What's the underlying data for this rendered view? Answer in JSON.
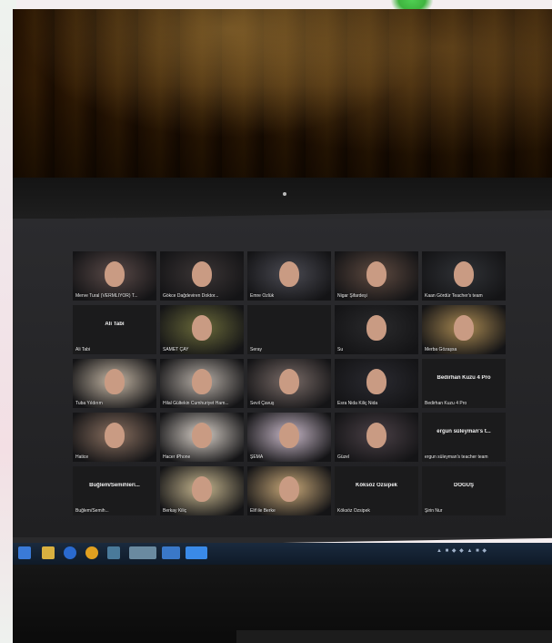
{
  "scene": "photo of a laptop screen showing a video conference gallery view",
  "participants": [
    {
      "name": "Merve Tural (VERMLİYOR) T...",
      "kind": "video"
    },
    {
      "name": "Gökce Dağdeviren Doktor...",
      "kind": "video"
    },
    {
      "name": "Emre Özlük",
      "kind": "video"
    },
    {
      "name": "Nigar Şifardeşi",
      "kind": "video"
    },
    {
      "name": "Kaan Gördür Teacher's team",
      "kind": "video"
    },
    {
      "name": "Ali Tabi",
      "kind": "name",
      "label": "Ali Tabi"
    },
    {
      "name": "SAMET ÇAY",
      "kind": "video"
    },
    {
      "name": "Seray",
      "kind": "blank"
    },
    {
      "name": "Su",
      "kind": "video"
    },
    {
      "name": "Merba Gözaşsa",
      "kind": "video"
    },
    {
      "name": "Tuba Yıldırım",
      "kind": "video"
    },
    {
      "name": "Hilal Gültekin Cumhuriyet Ham...",
      "kind": "video"
    },
    {
      "name": "Sevil Çavuş",
      "kind": "video"
    },
    {
      "name": "Esra Nida Kiliç Nida",
      "kind": "video"
    },
    {
      "name": "Bedirhan Kuzu 4 Pro",
      "kind": "name",
      "label": "Bedirhan Kuzu 4 Pro"
    },
    {
      "name": "Hatice",
      "kind": "video"
    },
    {
      "name": "Hacer iPhone",
      "kind": "video"
    },
    {
      "name": "ŞEMA",
      "kind": "video"
    },
    {
      "name": "Güzel",
      "kind": "video"
    },
    {
      "name": "ergun süleyman's teacher team",
      "kind": "name",
      "label": "ergun süleyman's t...",
      "active": true
    },
    {
      "name": "Buğlem/Semih...",
      "kind": "name",
      "label": "Buğlem/Semihleri..."
    },
    {
      "name": "Berkay Kiliç",
      "kind": "video"
    },
    {
      "name": "Elif ile Berke",
      "kind": "video"
    },
    {
      "name": "Köksöz Özsipek",
      "kind": "name",
      "label": "Köksöz Özsipek"
    },
    {
      "name": "Şirin Nur",
      "kind": "name",
      "label": "DOĞUŞ"
    }
  ],
  "tile_colors": [
    "#5a4a48",
    "#3b3535",
    "#4a4a52",
    "#5e4a40",
    "#303236",
    "#1b1b1c",
    "#6a6a3a",
    "#1b1b1c",
    "#2a2a2c",
    "#aa8a52",
    "#c6b8a6",
    "#b8b0a8",
    "#7a6c68",
    "#2a2a30",
    "#1b1b1c",
    "#8a7060",
    "#d8d0c8",
    "#c8b8c8",
    "#4a4046",
    "#1b1b1c",
    "#1b1b1c",
    "#c8b890",
    "#c8a878",
    "#1b1b1c",
    "#1b1b1c"
  ],
  "taskbar": {
    "tray_text": "▲ ■ ◆ ◆ ▲ ■ ◆"
  },
  "colors": {
    "active_border": "#c8d82a",
    "accent_leaf": "#3fb43f"
  }
}
